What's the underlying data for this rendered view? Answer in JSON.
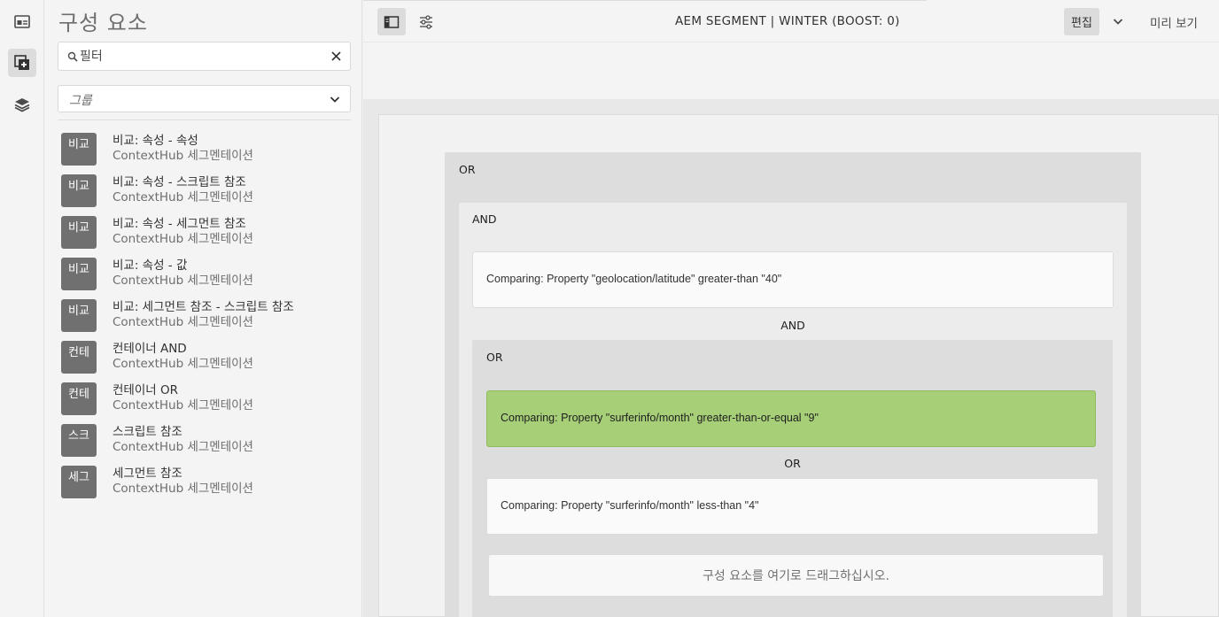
{
  "rail": {
    "items": [
      {
        "icon": "page-info-icon",
        "active": false
      },
      {
        "icon": "components-icon",
        "active": true
      },
      {
        "icon": "layers-icon",
        "active": false
      }
    ]
  },
  "panel": {
    "title": "구성 요소",
    "search_placeholder": "필터",
    "group_value": "그룹",
    "components": [
      {
        "tile": "비교",
        "name": "비교: 속성 - 속성",
        "group": "ContextHub 세그멘테이션"
      },
      {
        "tile": "비교",
        "name": "비교: 속성 - 스크립트 참조",
        "group": "ContextHub 세그멘테이션"
      },
      {
        "tile": "비교",
        "name": "비교: 속성 - 세그먼트 참조",
        "group": "ContextHub 세그멘테이션"
      },
      {
        "tile": "비교",
        "name": "비교: 속성 - 값",
        "group": "ContextHub 세그멘테이션"
      },
      {
        "tile": "비교",
        "name": "비교: 세그먼트 참조 - 스크립트 참조",
        "group": "ContextHub 세그멘테이션"
      },
      {
        "tile": "컨테",
        "name": "컨테이너 AND",
        "group": "ContextHub 세그멘테이션"
      },
      {
        "tile": "컨테",
        "name": "컨테이너 OR",
        "group": "ContextHub 세그멘테이션"
      },
      {
        "tile": "스크",
        "name": "스크립트 참조",
        "group": "ContextHub 세그멘테이션"
      },
      {
        "tile": "세그",
        "name": "세그먼트 참조",
        "group": "ContextHub 세그멘테이션"
      }
    ]
  },
  "toolbar": {
    "title": "AEM SEGMENT | WINTER (BOOST: 0)",
    "edit_label": "편집",
    "preview_label": "미리 보기"
  },
  "canvas": {
    "outer_label": "OR",
    "and_label": "AND",
    "rule1": "Comparing: Property \"geolocation/latitude\" greater-than \"40\"",
    "and_operator": "AND",
    "inner_label": "OR",
    "rule2": "Comparing: Property \"surferinfo/month\" greater-than-or-equal \"9\"",
    "or_operator": "OR",
    "rule3": "Comparing: Property \"surferinfo/month\" less-than \"4\"",
    "drop_hint": "구성 요소를 여기로 드래그하십시오."
  },
  "colors": {
    "selected_rule": "#a6cf78",
    "tile": "#707070",
    "active_button": "#dcdcdc"
  }
}
